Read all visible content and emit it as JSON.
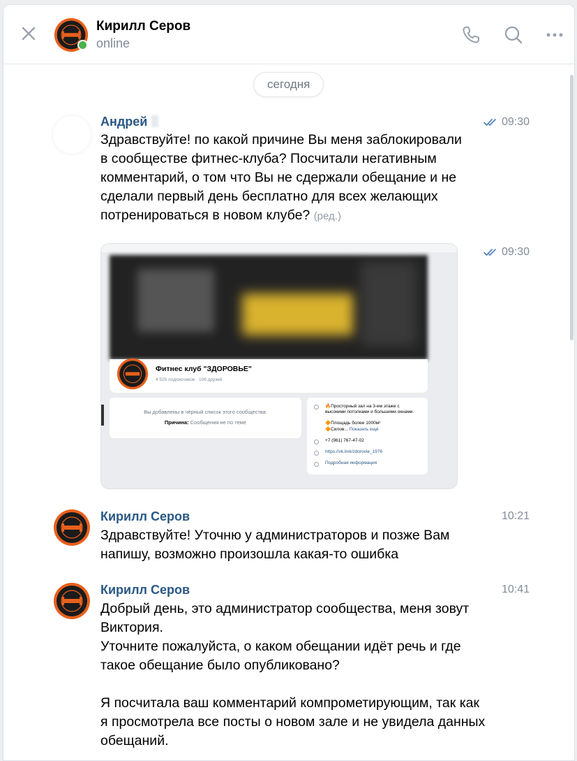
{
  "header": {
    "title": "Кирилл Серов",
    "status": "online"
  },
  "date_divider": "сегодня",
  "messages": [
    {
      "sender": "Андрей",
      "time": "09:30",
      "text": "Здравствуйте! по какой причине Вы меня заблокировали\nв сообществе фитнес-клуба? Посчитали негативным\nкомментарий, о том что Вы не сдержали обещание и не\nсделали первый день бесплатно для всех желающих\nпотренироваться в новом клубе?",
      "edited_label": "(ред.)"
    },
    {
      "time": "09:30",
      "attachment": {
        "club_name": "Фитнес клуб \"ЗДОРОВЬЕ\"",
        "subscribers": "4 525 подписчиков · 106 друзей",
        "blacklist_notice": "Вы добавлены в чёрный список этого сообщества.",
        "reason_label": "Причина:",
        "reason_value": "Сообщения не по теме",
        "info_line_1": "🔥Просторный зал на 3-ем этаже с",
        "info_line_2": "высокими потолками и большими окнами.",
        "info_line_3": "🔶Площадь более 1000м²",
        "info_line_4": "🔶Силов...",
        "show_more": "Показать ещё",
        "phone": "+7 (961) 767-47-02",
        "link": "https://vk.link/zdorovie_1976",
        "details": "Подробная информация"
      }
    },
    {
      "sender": "Кирилл Серов",
      "time": "10:21",
      "text": "Здравствуйте! Уточню у администраторов и позже Вам\nнапишу, возможно произошла какая-то ошибка"
    },
    {
      "sender": "Кирилл Серов",
      "time": "10:41",
      "text": "Добрый день, это администратор сообщества, меня зовут\nВиктория.\nУточните пожалуйста, о каком обещании идёт речь и где\nтакое обещание было опубликовано?\n\nЯ посчитала ваш комментарий компрометирующим, так как\nя просмотрела все посты о новом зале и не увидела данных\nобещаний."
    }
  ],
  "colors": {
    "link": "#2a5885",
    "secondary_text": "#818c99",
    "online": "#4bb34b",
    "logo_orange": "#e8601c"
  }
}
